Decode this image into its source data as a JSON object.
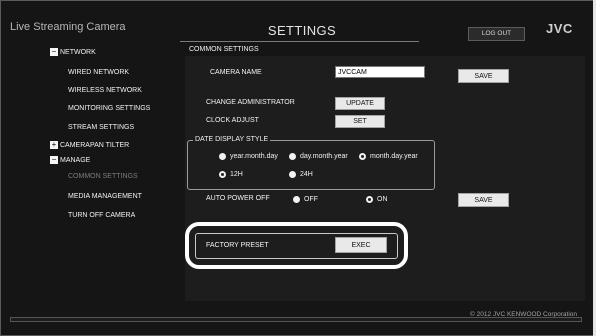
{
  "header": {
    "app_title": "Live Streaming Camera",
    "page_title": "SETTINGS",
    "logout_label": "LOG OUT",
    "brand": "JVC"
  },
  "sidebar": {
    "network": "NETWORK",
    "wired_network": "WIRED NETWORK",
    "wireless_network": "WIRELESS NETWORK",
    "monitoring_settings": "MONITORING SETTINGS",
    "stream_settings": "STREAM SETTINGS",
    "camera_pan_tilter": "CAMERAPAN TILTER",
    "manage": "MANAGE",
    "common_settings": "COMMON SETTINGS",
    "media_management": "MEDIA MANAGEMENT",
    "turn_off_camera": "TURN OFF CAMERA"
  },
  "panel": {
    "heading": "COMMON SETTINGS",
    "camera_name_label": "CAMERA NAME",
    "camera_name_value": "JVCCAM",
    "save_label": "SAVE",
    "change_admin_label": "CHANGE ADMINISTRATOR",
    "update_label": "UPDATE",
    "clock_adjust_label": "CLOCK ADJUST",
    "set_label": "SET",
    "date_display_style": "DATE DISPLAY STYLE",
    "date_options": [
      "year.month.day",
      "day.month.year",
      "month.day.year"
    ],
    "date_selected": "month.day.year",
    "time_options": [
      "12H",
      "24H"
    ],
    "time_selected": "12H",
    "auto_power_off_label": "AUTO POWER OFF",
    "power_options": [
      "OFF",
      "ON"
    ],
    "power_selected": "ON",
    "save2_label": "SAVE",
    "factory_preset_label": "FACTORY PRESET",
    "exec_label": "EXEC"
  },
  "footer": {
    "copyright": "© 2012 JVC KENWOOD Corporation"
  },
  "colors": {
    "background": "#151515",
    "panel": "#1d1d1d",
    "button": "#e9e9e9"
  }
}
